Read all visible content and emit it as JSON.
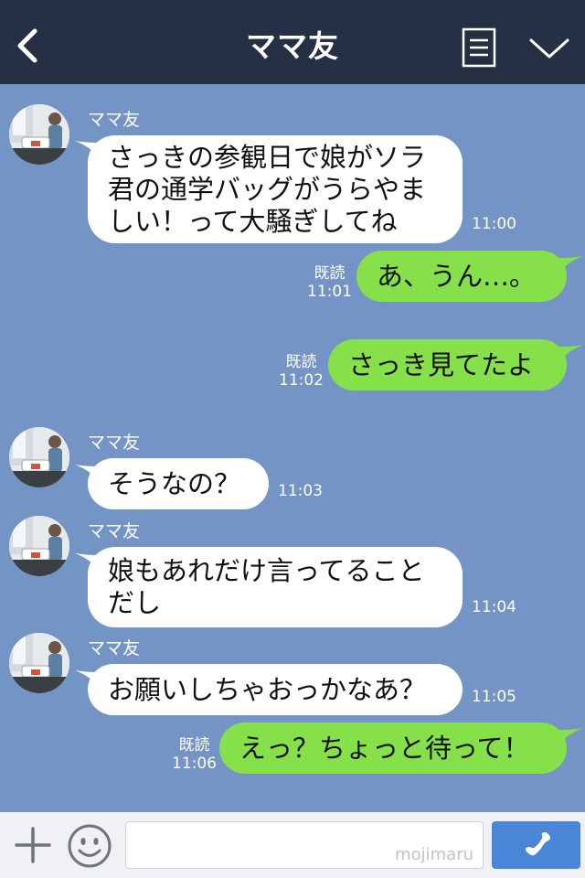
{
  "header": {
    "title": "ママ友"
  },
  "messages": [
    {
      "side": "left",
      "sender": "ママ友",
      "text": "さっきの参観日で娘がソラ\n君の通学バッグがうらやま\nしい！って大騒ぎしてね",
      "time": "11:00"
    },
    {
      "side": "right",
      "read": "既読",
      "text": "あ、うん…。",
      "time": "11:01"
    },
    {
      "side": "right",
      "read": "既読",
      "text": "さっき見てたよ",
      "time": "11:02"
    },
    {
      "side": "left",
      "sender": "ママ友",
      "text": "そうなの？",
      "time": "11:03"
    },
    {
      "side": "left",
      "sender": "ママ友",
      "text": "娘もあれだけ言ってること\nだし",
      "time": "11:04"
    },
    {
      "side": "left",
      "sender": "ママ友",
      "text": "お願いしちゃおっかなあ？",
      "time": "11:05"
    },
    {
      "side": "right",
      "read": "既読",
      "text": "えっ？ちょっと待って！",
      "time": "11:06"
    }
  ],
  "input": {
    "watermark": "mojimaru"
  },
  "colors": {
    "header_bg": "#253045",
    "chat_bg": "#7494c5",
    "bubble_mine": "#86e04a",
    "bubble_theirs": "#ffffff",
    "call_button": "#4a86d8"
  },
  "icons": [
    "back-chevron-icon",
    "menu-list-icon",
    "chevron-down-icon",
    "plus-icon",
    "smiley-icon",
    "phone-icon"
  ]
}
